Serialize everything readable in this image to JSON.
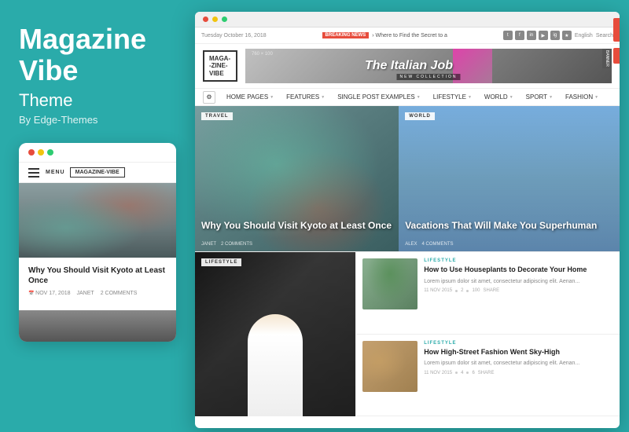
{
  "left": {
    "brand": "Magazine Vibe",
    "brand_line1": "Magazine",
    "brand_line2": "Vibe",
    "subtitle": "Theme",
    "by": "By Edge-Themes",
    "mobile": {
      "dots": [
        "red",
        "yellow",
        "green"
      ],
      "menu_label": "MENU",
      "logo": "MAGAZINE-VIBE",
      "article_title": "Why You Should Visit Kyoto at Least Once",
      "meta_date": "NOV 17, 2018",
      "meta_author": "JANET",
      "meta_comments": "2 COMMENTS"
    }
  },
  "browser": {
    "topbar": {
      "date": "Tuesday October 16, 2018",
      "breaking_label": "BREAKING NEWS",
      "breaking_text": "› Where to Find the Secret to a",
      "lang": "English",
      "search": "Search"
    },
    "header": {
      "logo_line1": "MAGA-",
      "logo_line2": "-ZINE-",
      "logo_line3": "VIBE",
      "banner_size": "760 × 100",
      "banner_text": "The Italian Job",
      "banner_new_collection": "NEW COLLECTION",
      "banner_label": "BANNER"
    },
    "nav": {
      "items": [
        {
          "label": "HOME PAGES",
          "has_arrow": true
        },
        {
          "label": "FEATURES",
          "has_arrow": true
        },
        {
          "label": "SINGLE POST EXAMPLES",
          "has_arrow": true
        },
        {
          "label": "LIFESTYLE",
          "has_arrow": true
        },
        {
          "label": "WORLD",
          "has_arrow": true
        },
        {
          "label": "SPORT",
          "has_arrow": true
        },
        {
          "label": "FASHION",
          "has_arrow": true
        }
      ]
    },
    "hero": {
      "left": {
        "tag": "TRAVEL",
        "title": "Why You Should Visit Kyoto at Least Once",
        "meta_author": "JANET",
        "meta_comments": "2 COMMENTS"
      },
      "right": {
        "tag": "WORLD",
        "title": "Vacations That Will Make You Superhuman",
        "meta_author": "ALEX",
        "meta_comments": "4 COMMENTS"
      }
    },
    "lower": {
      "left_tag": "LIFESTYLE",
      "articles": [
        {
          "tag": "LIFESTYLE",
          "title": "How to Use Houseplants to Decorate Your Home",
          "excerpt": "Lorem ipsum dolor sit amet, consectetur adipiscing elit. Aenan...",
          "date": "11 NOV 2015",
          "likes": "2",
          "comments": "100",
          "share": "SHARE"
        },
        {
          "tag": "LIFESTYLE",
          "title": "How High-Street Fashion Went Sky-High",
          "excerpt": "Lorem ipsum dolor sit amet, consectetur adipiscing elit. Aenan...",
          "date": "11 NOV 2015",
          "likes": "4",
          "comments": "6",
          "share": "SHARE"
        }
      ]
    }
  }
}
